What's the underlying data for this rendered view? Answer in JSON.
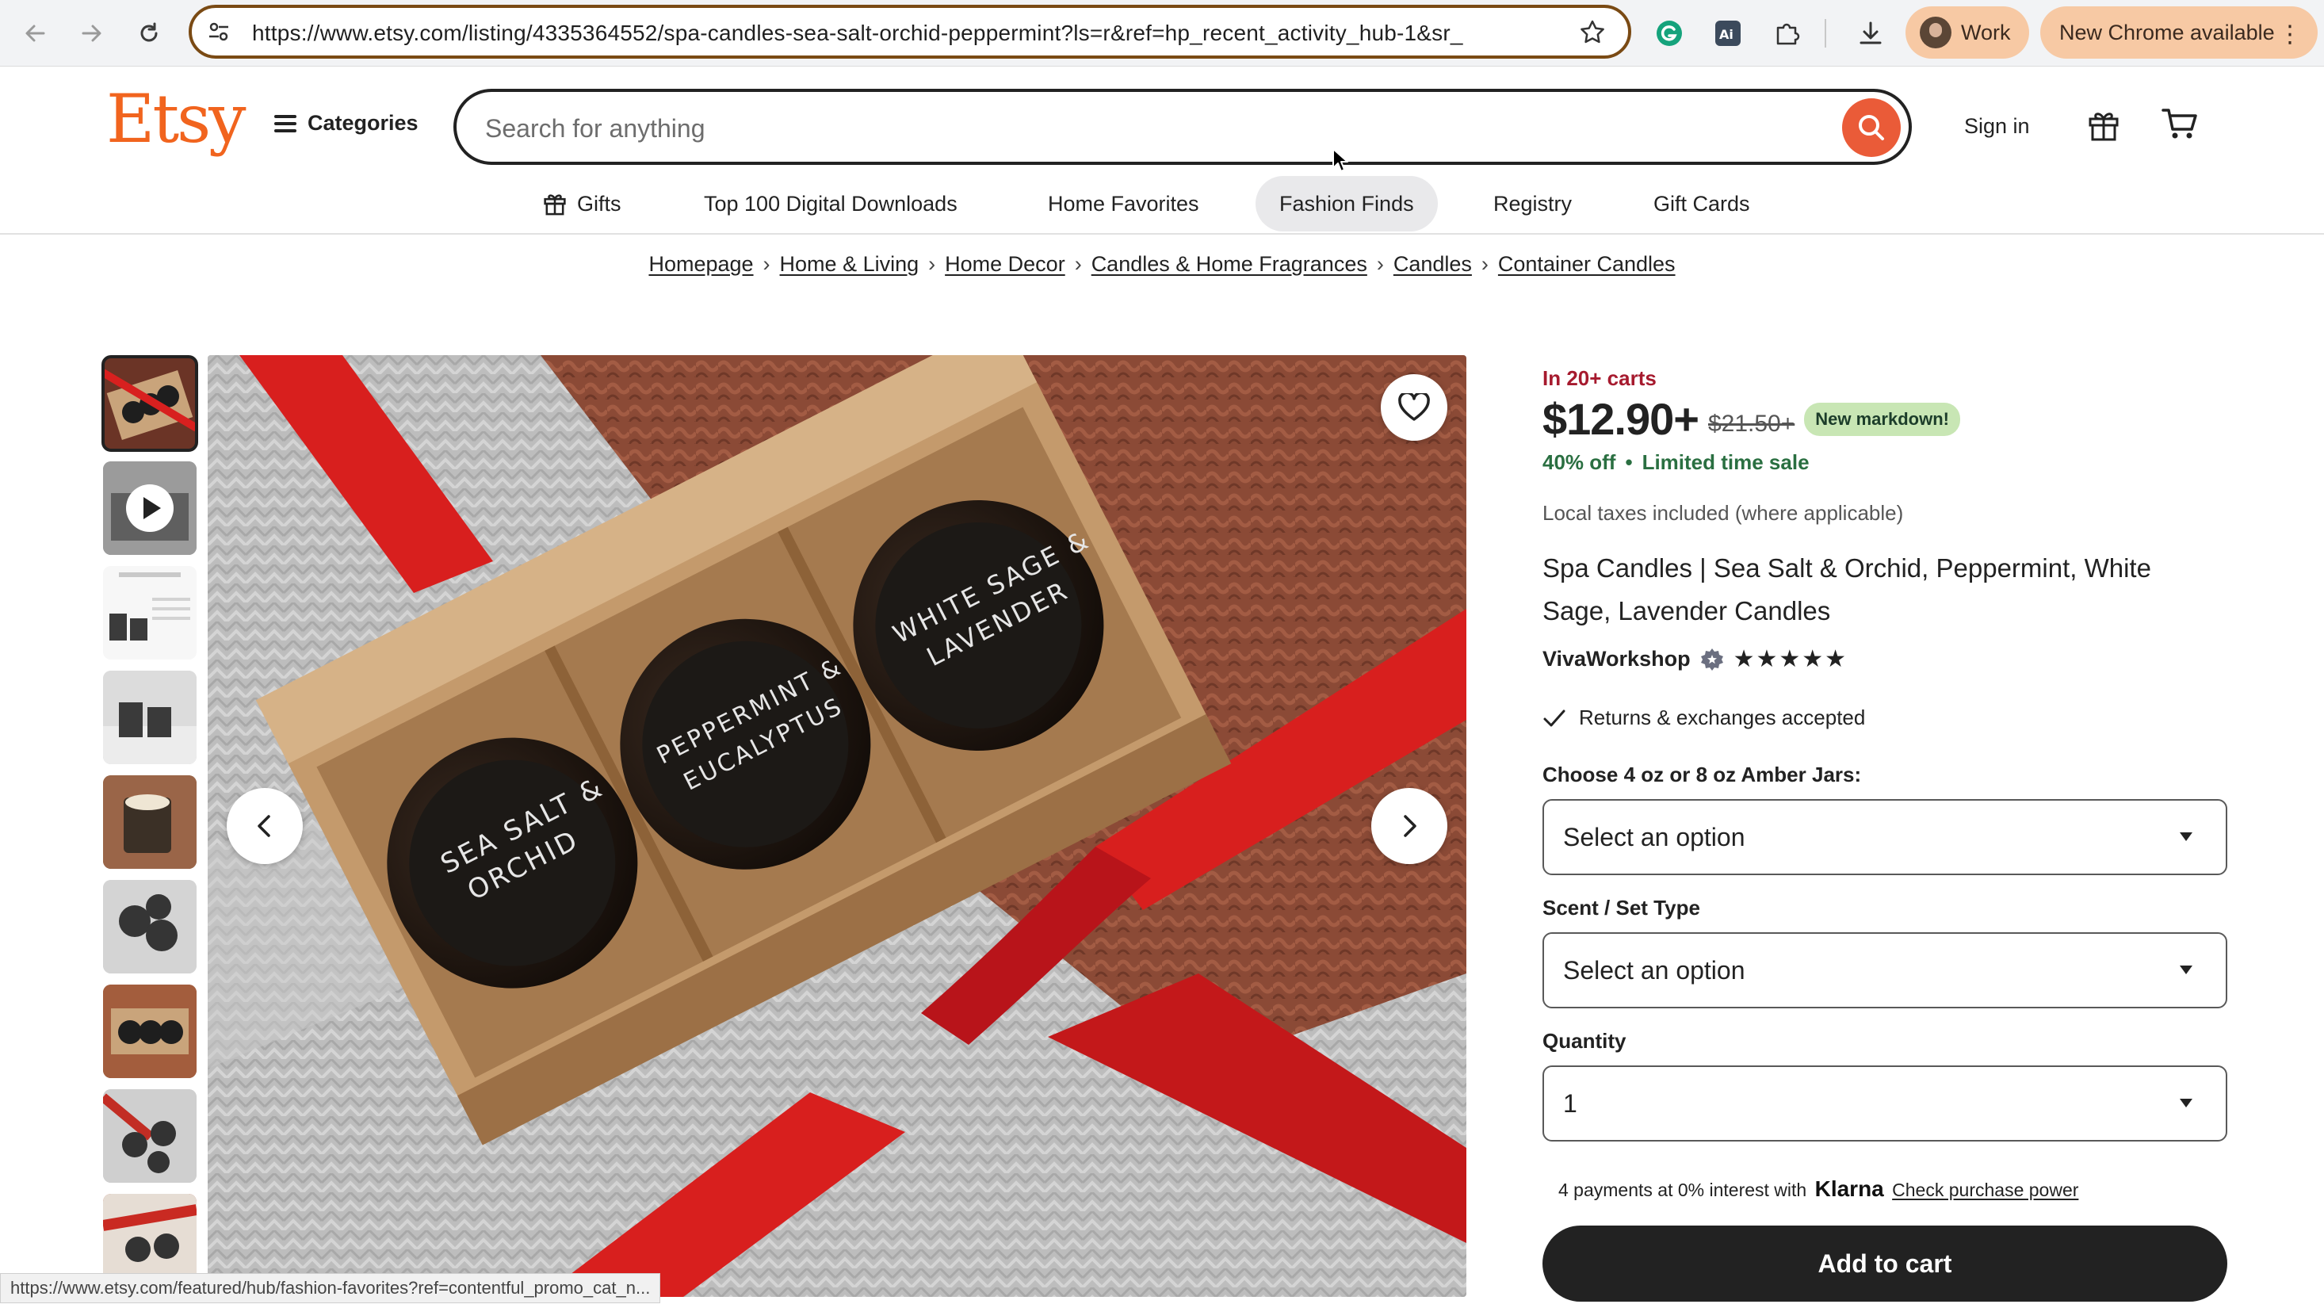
{
  "browser": {
    "url": "https://www.etsy.com/listing/4335364552/spa-candles-sea-salt-orchid-peppermint?ls=r&ref=hp_recent_activity_hub-1&sr_",
    "profile_name": "Work",
    "update_label": "New Chrome available",
    "status_url": "https://www.etsy.com/featured/hub/fashion-favorites?ref=contentful_promo_cat_n..."
  },
  "header": {
    "logo": "Etsy",
    "categories_label": "Categories",
    "search_placeholder": "Search for anything",
    "sign_in": "Sign in",
    "accent_color": "#f1641e"
  },
  "subnav": {
    "items": [
      {
        "label": "Gifts",
        "icon": "gift-icon"
      },
      {
        "label": "Top 100 Digital Downloads"
      },
      {
        "label": "Home Favorites"
      },
      {
        "label": "Fashion Finds",
        "active": true
      },
      {
        "label": "Registry"
      },
      {
        "label": "Gift Cards"
      }
    ]
  },
  "breadcrumb": [
    "Homepage",
    "Home & Living",
    "Home Decor",
    "Candles & Home Fragrances",
    "Candles",
    "Container Candles"
  ],
  "gallery": {
    "jar_labels": [
      "SEA SALT & ORCHID",
      "PEPPERMINT & EUCALYPTUS",
      "WHITE SAGE & LAVENDER"
    ],
    "thumbnail_count": 9,
    "selected_thumbnail": 1,
    "video_thumbnail": 2
  },
  "product": {
    "carts_text": "In 20+ carts",
    "price": "$12.90+",
    "old_price": "$21.50+",
    "markdown_badge": "New markdown!",
    "discount": "40% off",
    "sale_text": "Limited time sale",
    "taxes": "Local taxes included (where applicable)",
    "title": "Spa Candles | Sea Salt & Orchid, Peppermint, White Sage, Lavender Candles",
    "shop_name": "VivaWorkshop",
    "rating_stars": 5,
    "stars_text": "★★★★★",
    "returns": "Returns & exchanges accepted",
    "option1_label": "Choose 4 oz or 8 oz Amber Jars:",
    "option1_value": "Select an option",
    "option2_label": "Scent / Set Type",
    "option2_value": "Select an option",
    "quantity_label": "Quantity",
    "quantity_value": "1",
    "klarna_prefix": "4 payments at 0% interest with",
    "klarna_brand": "Klarna",
    "klarna_link": "Check purchase power",
    "add_to_cart": "Add to cart",
    "price_color": "#a61a2e",
    "sale_color": "#2a6f41"
  }
}
